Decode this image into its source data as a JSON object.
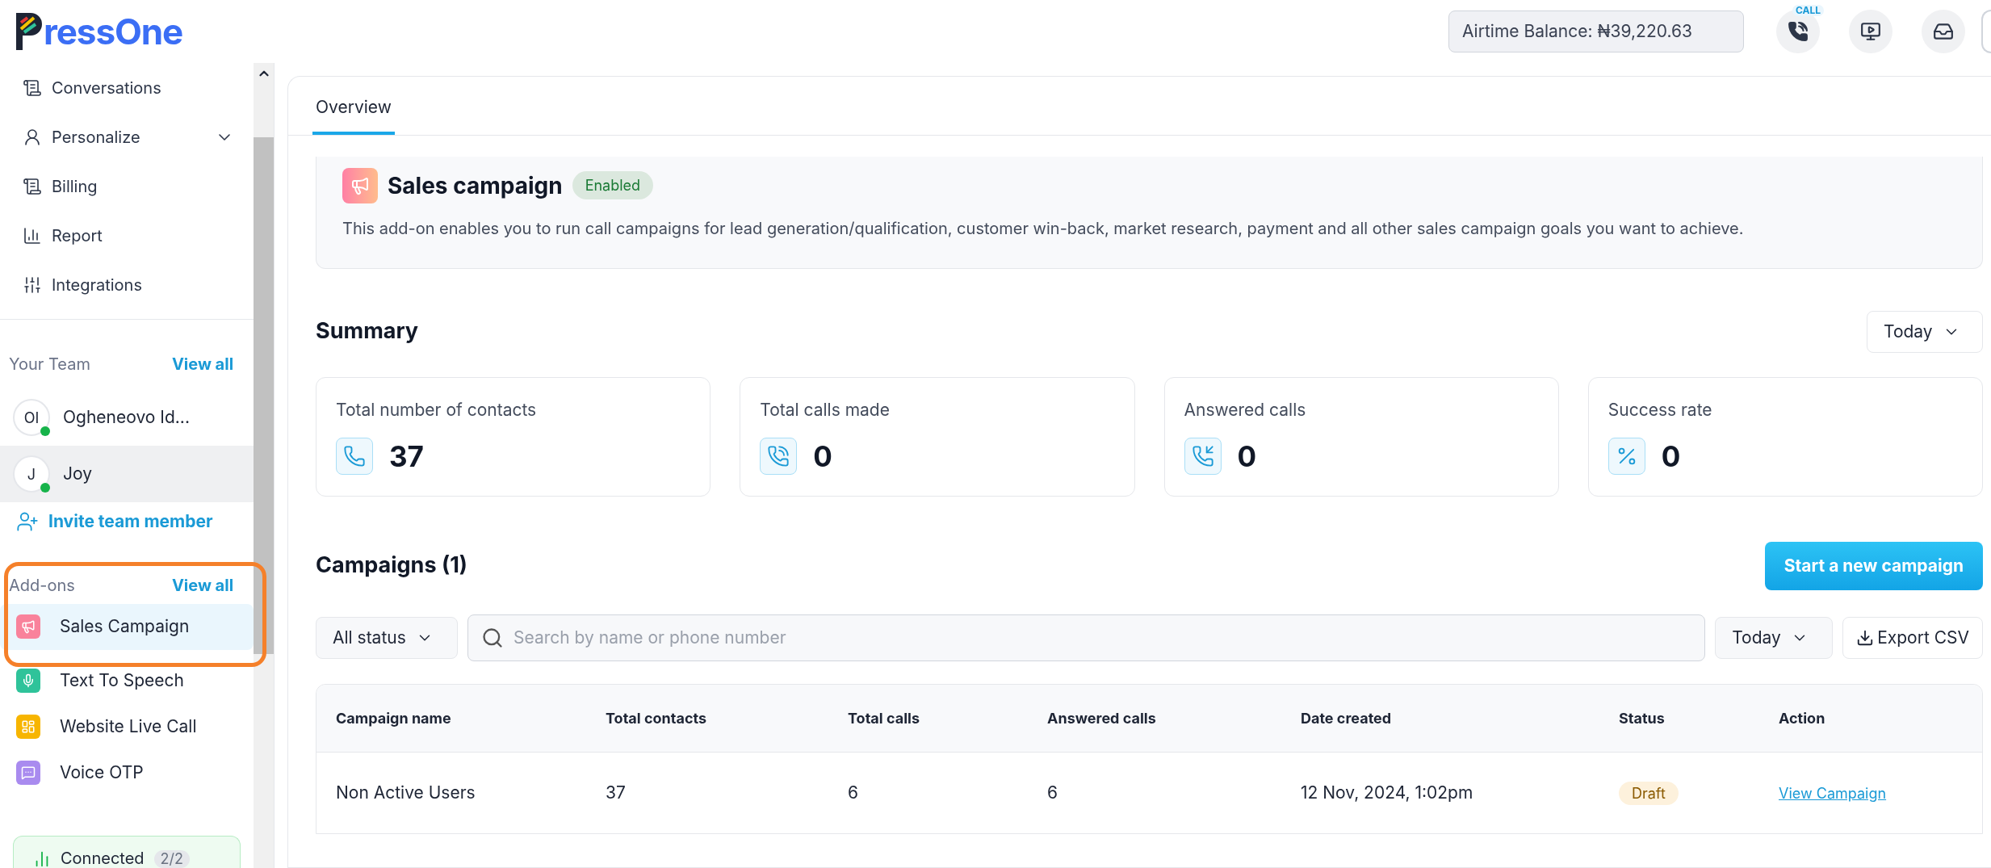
{
  "logo": {
    "text": "ressOne"
  },
  "topbar": {
    "balance": "Airtime Balance: ₦39,220.63",
    "call_badge": "CALL"
  },
  "sidebar": {
    "nav": [
      {
        "label": "Conversations",
        "expandable": false
      },
      {
        "label": "Personalize",
        "expandable": true
      },
      {
        "label": "Billing",
        "expandable": false
      },
      {
        "label": "Report",
        "expandable": false
      },
      {
        "label": "Integrations",
        "expandable": false
      }
    ],
    "team": {
      "title": "Your Team",
      "view_all": "View all",
      "members": [
        {
          "initials": "OI",
          "name": "Ogheneovo Id...",
          "selected": false
        },
        {
          "initials": "J",
          "name": "Joy",
          "selected": true
        }
      ],
      "invite": "Invite team member"
    },
    "addons": {
      "title": "Add-ons",
      "view_all": "View all",
      "items": [
        {
          "label": "Sales Campaign",
          "color": "#f9829b",
          "selected": true
        },
        {
          "label": "Text To Speech",
          "color": "#2fc39a",
          "selected": false
        },
        {
          "label": "Website Live Call",
          "color": "#f7b500",
          "selected": false
        },
        {
          "label": "Voice OTP",
          "color": "#a98bef",
          "selected": false
        }
      ]
    },
    "status": {
      "label": "Connected",
      "count": "2/2"
    }
  },
  "tabs": [
    {
      "label": "Overview",
      "selected": true
    }
  ],
  "addon_header": {
    "title": "Sales campaign",
    "badge": "Enabled",
    "description": "This add-on enables you to run call campaigns for lead generation/qualification, customer win-back, market research, payment and all other sales campaign goals you want to achieve."
  },
  "summary": {
    "title": "Summary",
    "period": "Today",
    "cards": [
      {
        "label": "Total number of contacts",
        "value": "37"
      },
      {
        "label": "Total calls made",
        "value": "0"
      },
      {
        "label": "Answered calls",
        "value": "0"
      },
      {
        "label": "Success rate",
        "value": "0"
      }
    ]
  },
  "campaigns": {
    "title": "Campaigns (1)",
    "new_button": "Start a new campaign",
    "status_filter": "All status",
    "search": {
      "placeholder": "Search by name or phone number"
    },
    "period": "Today",
    "export": "Export CSV",
    "columns": [
      "Campaign name",
      "Total contacts",
      "Total calls",
      "Answered calls",
      "Date created",
      "Status",
      "Action"
    ],
    "rows": [
      {
        "name": "Non Active Users",
        "contacts": "37",
        "calls": "6",
        "answered": "6",
        "date": "12 Nov, 2024, 1:02pm",
        "status": "Draft",
        "action": "View Campaign"
      }
    ]
  }
}
